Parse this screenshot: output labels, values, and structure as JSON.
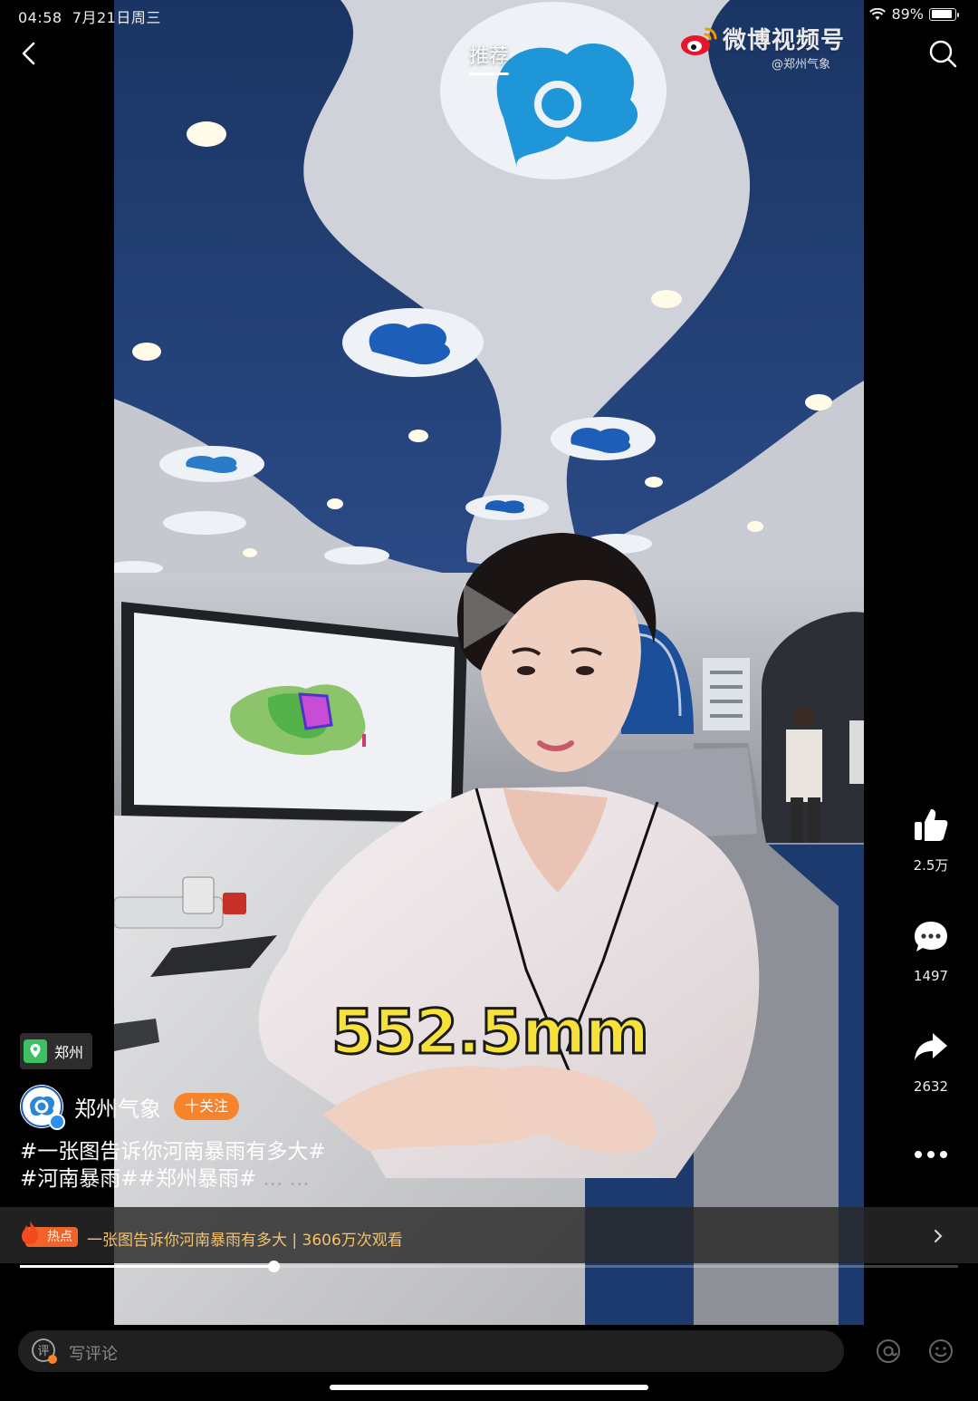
{
  "status_bar": {
    "time": "04:58",
    "date": "7月21日周三",
    "battery_percent_label": "89%",
    "battery_level": 0.89
  },
  "nav": {
    "tab_label": "推荐"
  },
  "watermark": {
    "title": "微博视频号",
    "handle": "@郑州气象"
  },
  "video": {
    "overlay_text": "552.5mm",
    "progress": 0.27
  },
  "actions": {
    "likes": "2.5万",
    "comments": "1497",
    "shares": "2632"
  },
  "location": {
    "label": "郑州"
  },
  "author": {
    "name": "郑州气象",
    "follow_label": "十关注"
  },
  "caption": {
    "line1": "#一张图告诉你河南暴雨有多大#",
    "line2": "#河南暴雨##郑州暴雨#",
    "ellipsis": " ... ..."
  },
  "hot": {
    "badge": "热点",
    "text": "一张图告诉你河南暴雨有多大 | 3606万次观看"
  },
  "comment": {
    "placeholder": "写评论"
  },
  "colors": {
    "accent_orange": "#f7832a",
    "hot_text": "#f5c26b",
    "overlay_yellow": "#f7e13b",
    "brand_blue": "#2d8ff0"
  },
  "icons": [
    "back-icon",
    "search-icon",
    "weibo-logo-icon",
    "like-icon",
    "comment-icon",
    "share-icon",
    "more-icon",
    "location-icon",
    "flame-icon",
    "chevron-right-icon",
    "mention-icon",
    "emoji-icon"
  ]
}
